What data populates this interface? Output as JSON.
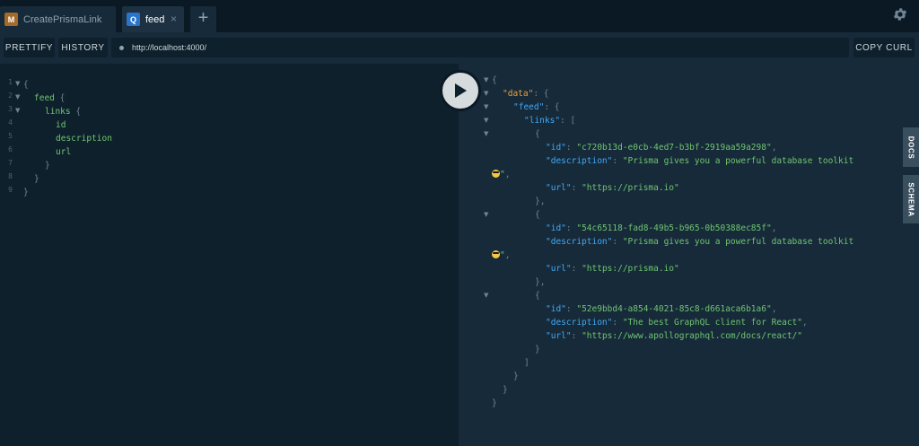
{
  "tabs": [
    {
      "badge": "M",
      "label": "CreatePrismaLink",
      "badge_color": "#a56a2a"
    },
    {
      "badge": "Q",
      "label": "feed",
      "badge_color": "#2a74c9",
      "close": "×"
    }
  ],
  "add_tab_label": "+",
  "toolbar": {
    "prettify": "PRETTIFY",
    "history": "HISTORY",
    "url": "http://localhost:4000/",
    "copy_curl": "COPY CURL"
  },
  "query_line_numbers": [
    "1",
    "2",
    "3",
    "4",
    "5",
    "6",
    "7",
    "8",
    "9"
  ],
  "query": {
    "open_brace": "{",
    "feed_field": "feed",
    "links_field": "links",
    "id_field": "id",
    "description_field": "description",
    "url_field": "url",
    "close_brace": "}"
  },
  "result": {
    "data_key": "\"data\"",
    "feed_key": "\"feed\"",
    "links_key": "\"links\"",
    "id_key": "\"id\"",
    "description_key": "\"description\"",
    "url_key": "\"url\"",
    "colon": ": ",
    "comma": ",",
    "links": [
      {
        "id": "\"c720b13d-e0cb-4ed7-b3bf-2919aa59a298\"",
        "description": "\"Prisma gives you a powerful database toolkit",
        "description_end": "\"",
        "url": "\"https://prisma.io\""
      },
      {
        "id": "\"54c65118-fad8-49b5-b965-0b50388ec85f\"",
        "description": "\"Prisma gives you a powerful database toolkit",
        "description_end": "\"",
        "url": "\"https://prisma.io\""
      },
      {
        "id": "\"52e9bbd4-a854-4021-85c8-d661aca6b1a6\"",
        "description": "\"The best GraphQL client for React\"",
        "url": "\"https://www.apollographql.com/docs/react/\""
      }
    ]
  },
  "side_tabs": {
    "docs": "DOCS",
    "schema": "SCHEMA"
  },
  "icons": {
    "play": "play-icon",
    "settings": "gear-icon",
    "emoji": "sunglasses-emoji-icon"
  }
}
